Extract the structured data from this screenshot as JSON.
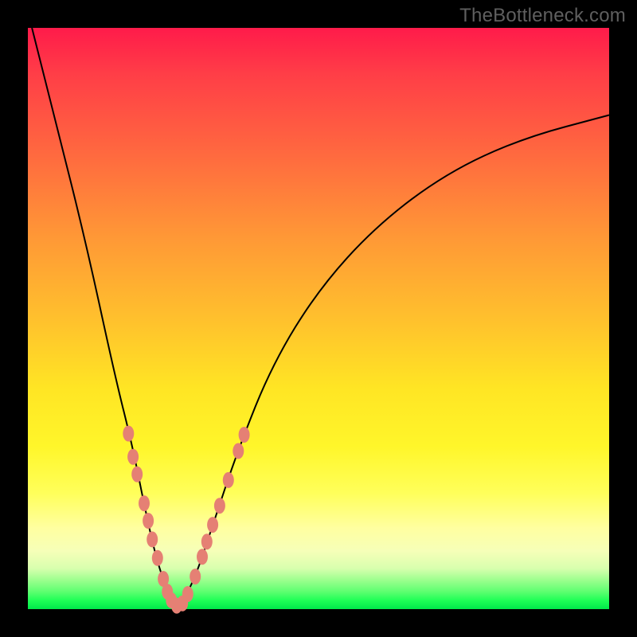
{
  "watermark": {
    "text": "TheBottleneck.com"
  },
  "colors": {
    "curve_stroke": "#000000",
    "marker_fill": "#e58074",
    "frame": "#000000"
  },
  "chart_data": {
    "type": "line",
    "title": "",
    "xlabel": "",
    "ylabel": "",
    "xlim": [
      0,
      1
    ],
    "ylim": [
      0,
      1
    ],
    "grid": false,
    "legend": false,
    "description": "Single V-shaped bottleneck curve over a vertical red-to-green gradient. No axes, ticks, or labels are rendered. Curve dips to y≈0 near x≈0.25 and rises on both sides. Salmon-colored oblong markers cluster along the lower portion of both curve arms.",
    "series": [
      {
        "name": "bottleneck-curve",
        "x": [
          0.007,
          0.05,
          0.1,
          0.15,
          0.18,
          0.2,
          0.22,
          0.24,
          0.255,
          0.27,
          0.29,
          0.32,
          0.36,
          0.42,
          0.5,
          0.6,
          0.72,
          0.85,
          1.0
        ],
        "y": [
          1.0,
          0.83,
          0.63,
          0.4,
          0.28,
          0.18,
          0.09,
          0.03,
          0.005,
          0.02,
          0.06,
          0.15,
          0.27,
          0.42,
          0.55,
          0.66,
          0.75,
          0.81,
          0.85
        ]
      }
    ],
    "markers": {
      "name": "highlight-points",
      "color": "#e58074",
      "points": [
        {
          "x": 0.173,
          "y": 0.302
        },
        {
          "x": 0.181,
          "y": 0.262
        },
        {
          "x": 0.188,
          "y": 0.232
        },
        {
          "x": 0.2,
          "y": 0.182
        },
        {
          "x": 0.207,
          "y": 0.152
        },
        {
          "x": 0.214,
          "y": 0.12
        },
        {
          "x": 0.223,
          "y": 0.088
        },
        {
          "x": 0.233,
          "y": 0.052
        },
        {
          "x": 0.24,
          "y": 0.03
        },
        {
          "x": 0.247,
          "y": 0.015
        },
        {
          "x": 0.256,
          "y": 0.006
        },
        {
          "x": 0.266,
          "y": 0.01
        },
        {
          "x": 0.275,
          "y": 0.026
        },
        {
          "x": 0.288,
          "y": 0.056
        },
        {
          "x": 0.3,
          "y": 0.09
        },
        {
          "x": 0.308,
          "y": 0.116
        },
        {
          "x": 0.318,
          "y": 0.145
        },
        {
          "x": 0.33,
          "y": 0.178
        },
        {
          "x": 0.345,
          "y": 0.222
        },
        {
          "x": 0.362,
          "y": 0.272
        },
        {
          "x": 0.372,
          "y": 0.3
        }
      ]
    }
  }
}
